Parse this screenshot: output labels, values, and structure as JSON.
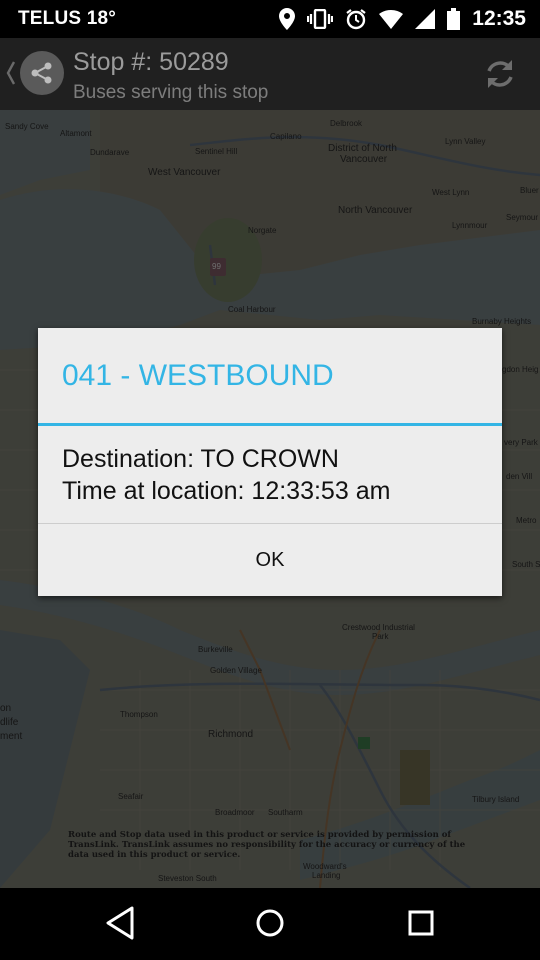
{
  "status_bar": {
    "carrier": "TELUS 18°",
    "time": "12:35"
  },
  "action_bar": {
    "title": "Stop #: 50289",
    "subtitle": "Buses serving this stop"
  },
  "map": {
    "labels": {
      "sandy_cove": "Sandy Cove",
      "altamont": "Altamont",
      "dundarave": "Dundarave",
      "sentinel_hill": "Sentinel Hill",
      "capilano": "Capilano",
      "delbrook": "Delbrook",
      "lynn_valley": "Lynn Valley",
      "district_nv_1": "District of North",
      "district_nv_2": "Vancouver",
      "west_vancouver": "West Vancouver",
      "west_lynn": "West Lynn",
      "blueridge": "Bluer",
      "north_vancouver": "North Vancouver",
      "lynnmour": "Lynnmour",
      "seymour": "Seymour",
      "norgate": "Norgate",
      "coal_harbour": "Coal Harbour",
      "burnaby_heights": "Burnaby Heights",
      "crestwood_1": "Crestwood Industrial",
      "crestwood_2": "Park",
      "burkeville": "Burkeville",
      "golden_village": "Golden Village",
      "thompson": "Thompson",
      "richmond": "Richmond",
      "seafair": "Seafair",
      "broadmoor": "Broadmoor",
      "southarm": "Southarm",
      "tilbury_island": "Tilbury Island",
      "steveston_south": "Steveston South",
      "woodwards_1": "Woodward's",
      "woodwards_2": "Landing",
      "on_edge": "on",
      "dlife_edge": "dlife",
      "ment_edge": "ment",
      "metro_edge": "Metro",
      "south_edge": "South S",
      "very_park_edge": "very Park",
      "den_vill_edge": "den Vill",
      "gdon_heig_edge": "gdon Heig",
      "hwy_99": "99"
    },
    "attribution": "Route and Stop data used in this product or service is provided by permission of TransLink. TransLink assumes no responsibility for the accuracy or currency of the data used in this product or service."
  },
  "dialog": {
    "title": "041 - WESTBOUND",
    "destination": "Destination: TO CROWN",
    "time_at_location": "Time at location: 12:33:53 am",
    "ok_label": "OK"
  },
  "colors": {
    "accent": "#33b5e5",
    "dialog_bg": "#ededed"
  },
  "icons": [
    "location-icon",
    "vibrate-icon",
    "alarm-icon",
    "wifi-icon",
    "signal-icon",
    "battery-icon",
    "share-icon",
    "refresh-icon",
    "back-icon",
    "home-icon",
    "recents-icon"
  ]
}
